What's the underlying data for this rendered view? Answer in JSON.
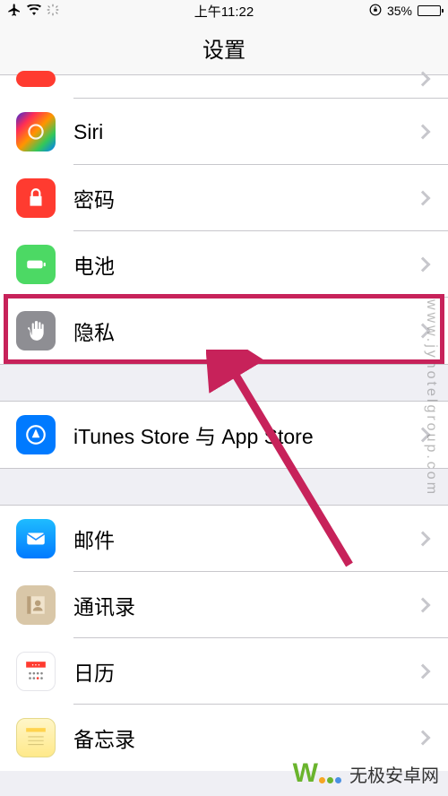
{
  "status": {
    "time": "上午11:22",
    "battery_pct": "35%"
  },
  "nav": {
    "title": "设置"
  },
  "rows": {
    "siri": "Siri",
    "passcode": "密码",
    "battery": "电池",
    "privacy": "隐私",
    "itunes": "iTunes Store 与 App Store",
    "mail": "邮件",
    "contacts": "通讯录",
    "calendar": "日历",
    "notes": "备忘录"
  },
  "watermark": "www.jyhotelgroup.com",
  "bottom_logo": "无极安卓网"
}
